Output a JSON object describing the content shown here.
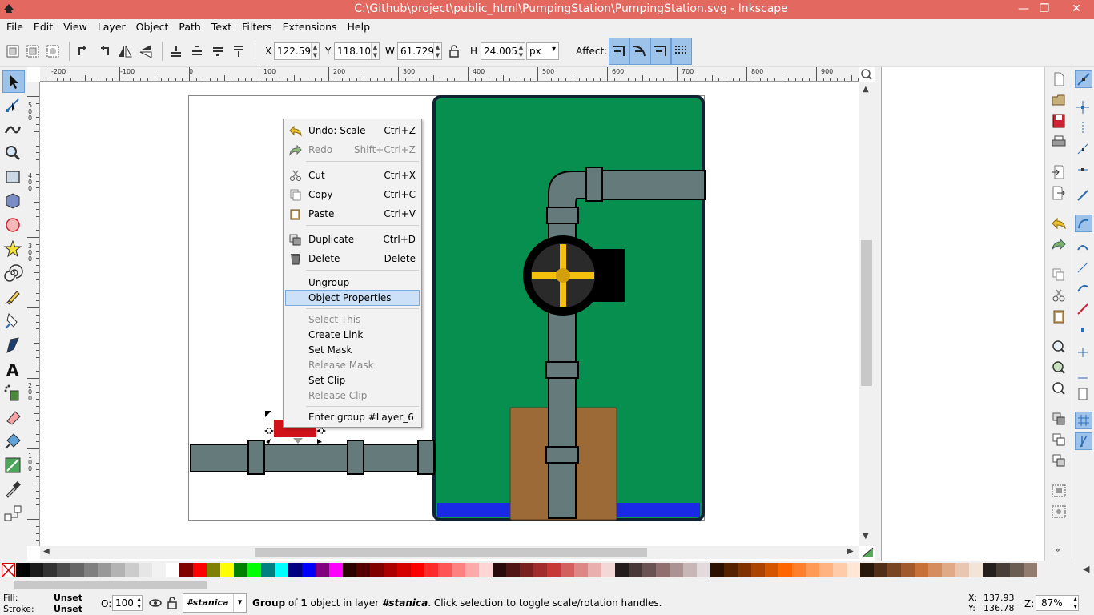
{
  "window": {
    "title": "C:\\Github\\project\\public_html\\PumpingStation\\PumpingStation.svg - Inkscape",
    "minimize": "—",
    "maximize": "❐",
    "close": "✕"
  },
  "menu": [
    "File",
    "Edit",
    "View",
    "Layer",
    "Object",
    "Path",
    "Text",
    "Filters",
    "Extensions",
    "Help"
  ],
  "toolbar": {
    "x_label": "X",
    "x_value": "122.599",
    "y_label": "Y",
    "y_value": "118.105",
    "w_label": "W",
    "w_value": "61.729",
    "h_label": "H",
    "h_value": "24.005",
    "unit": "px",
    "affect_label": "Affect:"
  },
  "ruler": {
    "h_labels": [
      "-200",
      "-100",
      "0",
      "100",
      "200",
      "300",
      "400",
      "500",
      "600",
      "700",
      "800",
      "900"
    ],
    "v_labels": [
      "5",
      "0",
      "0",
      "4",
      "0",
      "0",
      "3",
      "0",
      "0",
      "2",
      "0",
      "0",
      "1",
      "0",
      "0"
    ]
  },
  "context_menu": {
    "items": [
      {
        "label": "Undo: Scale",
        "shortcut": "Ctrl+Z",
        "icon": "undo-icon",
        "disabled": false
      },
      {
        "label": "Redo",
        "shortcut": "Shift+Ctrl+Z",
        "icon": "redo-icon",
        "disabled": true
      },
      {
        "label": "Cut",
        "shortcut": "Ctrl+X",
        "icon": "cut-icon",
        "disabled": false
      },
      {
        "label": "Copy",
        "shortcut": "Ctrl+C",
        "icon": "copy-icon",
        "disabled": false
      },
      {
        "label": "Paste",
        "shortcut": "Ctrl+V",
        "icon": "paste-icon",
        "disabled": false
      },
      {
        "label": "Duplicate",
        "shortcut": "Ctrl+D",
        "icon": "duplicate-icon",
        "disabled": false
      },
      {
        "label": "Delete",
        "shortcut": "Delete",
        "icon": "delete-icon",
        "disabled": false
      },
      {
        "label": "Ungroup",
        "shortcut": "",
        "disabled": false
      },
      {
        "label": "Object Properties",
        "shortcut": "",
        "disabled": false,
        "highlighted": true
      },
      {
        "label": "Select This",
        "shortcut": "",
        "disabled": true
      },
      {
        "label": "Create Link",
        "shortcut": "",
        "disabled": false
      },
      {
        "label": "Set Mask",
        "shortcut": "",
        "disabled": false
      },
      {
        "label": "Release Mask",
        "shortcut": "",
        "disabled": true
      },
      {
        "label": "Set Clip",
        "shortcut": "",
        "disabled": false
      },
      {
        "label": "Release Clip",
        "shortcut": "",
        "disabled": true
      },
      {
        "label": "Enter group #Layer_6",
        "shortcut": "",
        "disabled": false
      }
    ]
  },
  "status": {
    "fill_label": "Fill:",
    "fill_value": "Unset",
    "stroke_label": "Stroke:",
    "stroke_value": "Unset",
    "opacity_label": "O:",
    "opacity_value": "100",
    "layer": "#stanica",
    "message_bold1": "Group",
    "message_mid1": " of ",
    "message_bold2": "1",
    "message_mid2": " object in layer ",
    "message_bold3": "#stanica",
    "message_end": ". Click selection to toggle scale/rotation handles.",
    "x_label": "X:",
    "x_value": "137.93",
    "y_label": "Y:",
    "y_value": "136.78",
    "zoom_label": "Z:",
    "zoom_value": "87%"
  },
  "colors": {
    "titlebar": "#e3685f",
    "tank_green": "#068f4f",
    "pipe_gray": "#657a7a",
    "pump_yellow": "#f4c00f",
    "box_brown": "#9b6a36",
    "water_blue": "#1a29e6",
    "selected_red": "#d0121b"
  },
  "palette": [
    "#000000",
    "#1a1a1a",
    "#333333",
    "#4d4d4d",
    "#666666",
    "#808080",
    "#999999",
    "#b3b3b3",
    "#cccccc",
    "#e6e6e6",
    "#f2f2f2",
    "#ffffff",
    "#800000",
    "#ff0000",
    "#808000",
    "#ffff00",
    "#008000",
    "#00ff00",
    "#008080",
    "#00ffff",
    "#000080",
    "#0000ff",
    "#800080",
    "#ff00ff",
    "#2b0000",
    "#550000",
    "#800000",
    "#aa0000",
    "#d40000",
    "#ff0000",
    "#ff2a2a",
    "#ff5555",
    "#ff8080",
    "#ffaaaa",
    "#ffd5d5",
    "#280b0b",
    "#501616",
    "#782121",
    "#a02c2c",
    "#c83737",
    "#d35f5f",
    "#de8787",
    "#e9afaf",
    "#f4d7d7",
    "#241c1c",
    "#483737",
    "#6c5353",
    "#916f6f",
    "#ac9393",
    "#c8b7b7",
    "#e3dbdb",
    "#2b1100",
    "#552200",
    "#803300",
    "#aa4400",
    "#d45500",
    "#ff6600",
    "#ff7f2a",
    "#ff9955",
    "#ffb380",
    "#ffccaa",
    "#ffe6d5",
    "#28170b",
    "#502d16",
    "#784421",
    "#a05a2c",
    "#c87137",
    "#d38d5f",
    "#deaa87",
    "#e9c6af",
    "#f4e3d7",
    "#241f1c",
    "#483e37",
    "#6c5d53",
    "#917c6f"
  ]
}
